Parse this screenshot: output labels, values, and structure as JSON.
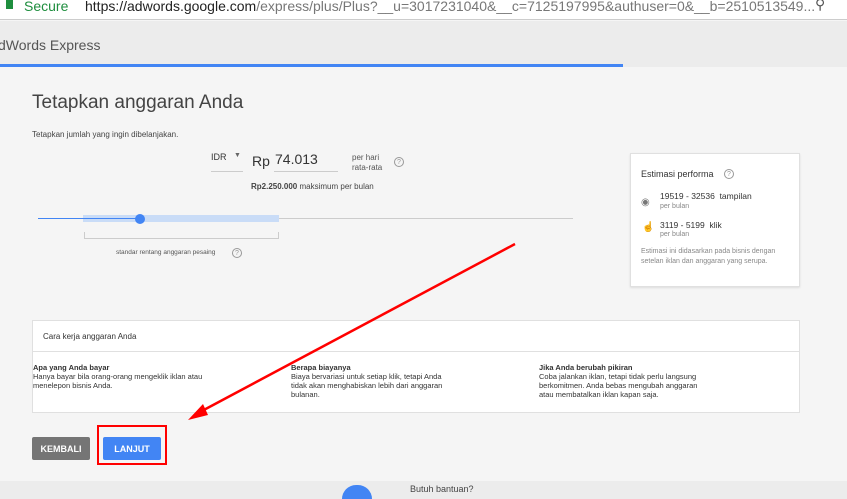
{
  "browser": {
    "secure_label": "Secure",
    "url_host": "https://adwords.google.com",
    "url_path": "/express/plus/Plus?__u=3017231040&__c=7125197995&authuser=0&__b=2510513549..."
  },
  "header": {
    "app_title": "dWords Express"
  },
  "page": {
    "title": "Tetapkan anggaran Anda",
    "subtitle": "Tetapkan jumlah yang ingin dibelanjakan.",
    "currency": "IDR",
    "currency_symbol": "Rp",
    "daily_budget": "74.013",
    "per_day_line1": "per hari",
    "per_day_line2": "rata-rata",
    "monthly_max_amount": "Rp2.250.000",
    "monthly_max_label": "maksimum per bulan",
    "slider_value_fraction": 0.19,
    "range_label": "standar rentang anggaran pesaing",
    "help": "?"
  },
  "estimate": {
    "title": "Estimasi performa",
    "impressions": "19519 - 32536",
    "impressions_unit": "tampilan",
    "clicks": "3119 - 5199",
    "clicks_unit": "klik",
    "per_month": "per bulan",
    "note": "Estimasi ini didasarkan pada bisnis dengan setelan iklan dan anggaran yang serupa."
  },
  "info": {
    "title": "Cara kerja anggaran Anda",
    "columns": [
      {
        "heading": "Apa yang Anda bayar",
        "text": "Hanya bayar bila orang-orang mengeklik iklan atau menelepon bisnis Anda."
      },
      {
        "heading": "Berapa biayanya",
        "text": "Biaya bervariasi untuk setiap klik, tetapi Anda tidak akan menghabiskan lebih dari anggaran bulanan."
      },
      {
        "heading": "Jika Anda berubah pikiran",
        "text": "Coba jalankan iklan, tetapi tidak perlu langsung berkomitmen. Anda bebas mengubah anggaran atau membatalkan iklan kapan saja."
      }
    ]
  },
  "buttons": {
    "back": "KEMBALI",
    "next": "LANJUT"
  },
  "footer": {
    "help_text": "Butuh bantuan?"
  },
  "colors": {
    "accent": "#4285f4",
    "annotation": "#ff0000",
    "back_button": "#757575"
  }
}
